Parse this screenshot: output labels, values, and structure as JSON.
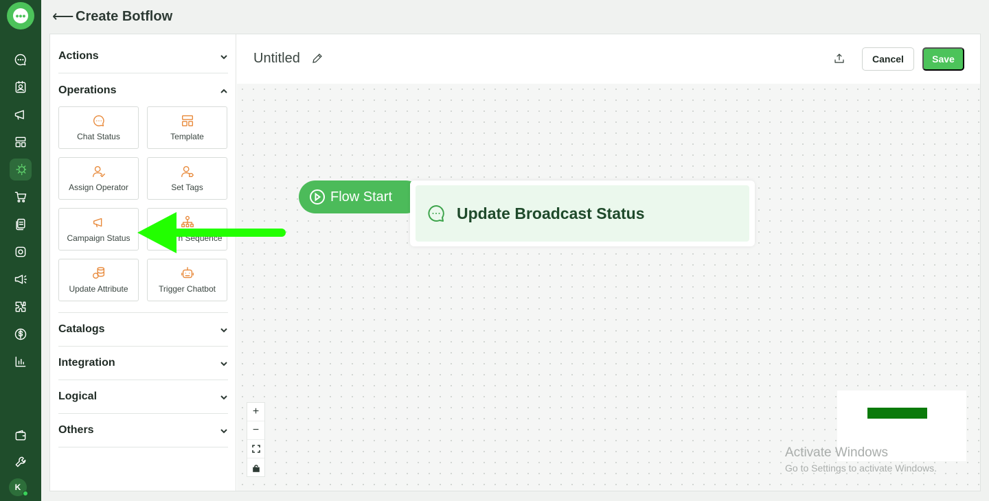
{
  "header": {
    "back_label": "⟵",
    "title": "Create Botflow"
  },
  "rail": {
    "brand_icon": "chat-logo-icon",
    "items": [
      "chat-icon",
      "contacts-icon",
      "megaphone-icon",
      "layout-icon",
      "botflow-icon",
      "cart-icon",
      "documents-icon",
      "instagram-icon",
      "broadcast-icon",
      "puzzle-icon",
      "dollar-icon",
      "analytics-icon",
      "wallet-icon",
      "wrench-icon"
    ],
    "active": "botflow-icon",
    "avatar": "K"
  },
  "sidebar": {
    "sections": {
      "actions": "Actions",
      "operations": "Operations",
      "catalogs": "Catalogs",
      "integration": "Integration",
      "logical": "Logical",
      "others": "Others"
    },
    "operations_items": [
      {
        "label": "Chat Status",
        "icon": "chat-bubble-icon"
      },
      {
        "label": "Template",
        "icon": "template-icon"
      },
      {
        "label": "Assign Operator",
        "icon": "user-check-icon"
      },
      {
        "label": "Set Tags",
        "icon": "user-tag-icon"
      },
      {
        "label": "Campaign Status",
        "icon": "megaphone-icon"
      },
      {
        "label": "n Sequence",
        "icon": "hierarchy-icon"
      },
      {
        "label": "Update Attribute",
        "icon": "database-icon"
      },
      {
        "label": "Trigger Chatbot",
        "icon": "robot-icon"
      }
    ]
  },
  "canvas": {
    "flow_name": "Untitled",
    "cancel_label": "Cancel",
    "save_label": "Save",
    "flow_start_label": "Flow Start",
    "node_title": "Update Broadcast Status",
    "zoom_in": "+",
    "zoom_out": "−"
  },
  "watermark": {
    "line1": "Activate Windows",
    "line2": "Go to Settings to activate Windows."
  },
  "colors": {
    "rail": "#1f4d2b",
    "accent": "#4cc35a",
    "card_icon": "#e8893a",
    "annotation_arrow": "#22ff00"
  }
}
